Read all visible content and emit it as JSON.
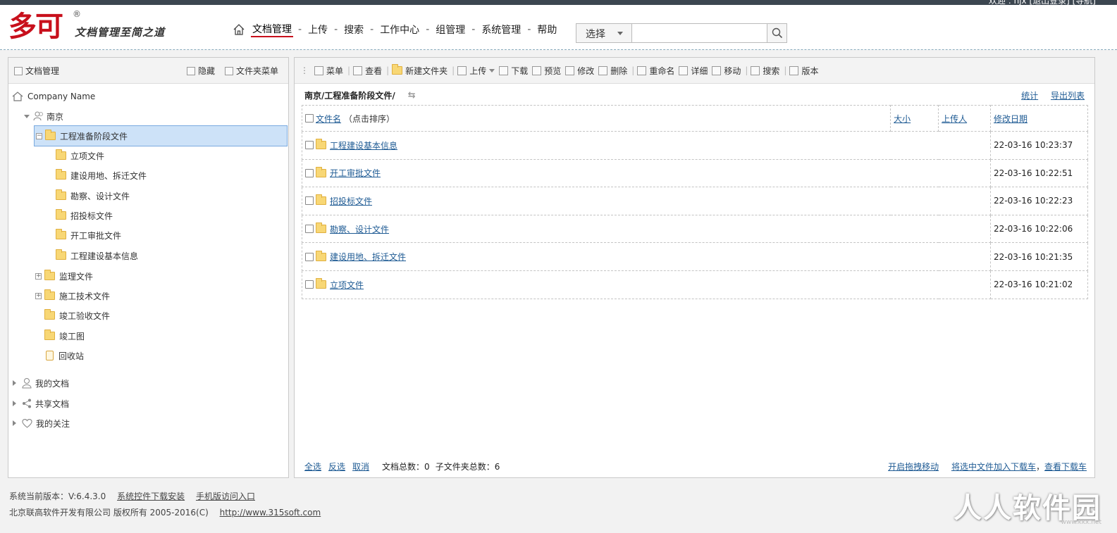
{
  "app": {
    "welcome": "欢迎 : hjx [退出登录] [导航]",
    "logo": "多可",
    "logo_reg": "®",
    "slogan": "文档管理至简之道"
  },
  "nav": {
    "items": [
      "文档管理",
      "上传",
      "搜索",
      "工作中心",
      "组管理",
      "系统管理",
      "帮助"
    ],
    "active": "文档管理"
  },
  "search": {
    "select_label": "选择",
    "value": ""
  },
  "left_panel": {
    "title": "文档管理",
    "hide_label": "隐藏",
    "folder_menu_label": "文件夹菜单",
    "company": "Company Name",
    "group": "南京",
    "selected_folder": "工程准备阶段文件",
    "subfolders": [
      "立项文件",
      "建设用地、拆迁文件",
      "勘察、设计文件",
      "招投标文件",
      "开工审批文件",
      "工程建设基本信息"
    ],
    "siblings": [
      "监理文件",
      "施工技术文件",
      "竣工验收文件",
      "竣工图"
    ],
    "recycle": "回收站",
    "sections": [
      "我的文档",
      "共享文档",
      "我的关注"
    ]
  },
  "toolbar": {
    "menu": "菜单",
    "view": "查看",
    "new_folder": "新建文件夹",
    "upload": "上传",
    "download": "下载",
    "preview": "预览",
    "edit": "修改",
    "delete": "删除",
    "rename": "重命名",
    "detail": "详细",
    "move": "移动",
    "search": "搜索",
    "version": "版本"
  },
  "content": {
    "path": "南京/工程准备阶段文件/",
    "stats_link": "统计",
    "export_link": "导出列表",
    "columns": {
      "name": "文件名",
      "name_hint": "（点击排序）",
      "size": "大小",
      "uploader": "上传人",
      "modified": "修改日期"
    },
    "rows": [
      {
        "name": "工程建设基本信息",
        "date": "22-03-16 10:23:37"
      },
      {
        "name": "开工审批文件",
        "date": "22-03-16 10:22:51"
      },
      {
        "name": "招投标文件",
        "date": "22-03-16 10:22:23"
      },
      {
        "name": "勘察、设计文件",
        "date": "22-03-16 10:22:06"
      },
      {
        "name": "建设用地、拆迁文件",
        "date": "22-03-16 10:21:35"
      },
      {
        "name": "立项文件",
        "date": "22-03-16 10:21:02"
      }
    ],
    "select_all": "全选",
    "invert": "反选",
    "cancel": "取消",
    "doc_total": "文档总数：0",
    "subfolder_total": "子文件夹总数：6",
    "drag_move": "开启拖拽移动",
    "add_to_cart": "将选中文件加入下载车",
    "view_cart": "查看下载车"
  },
  "footer": {
    "version": "系统当前版本：V:6.4.3.0",
    "control_download": "系统控件下载安装",
    "mobile": "手机版访问入口",
    "copyright": "北京联高软件开发有限公司 版权所有 2005-2016(C)",
    "url": "http://www.315soft.com"
  },
  "watermark": {
    "text": "人人软件园",
    "url": "www.kkx.net"
  }
}
